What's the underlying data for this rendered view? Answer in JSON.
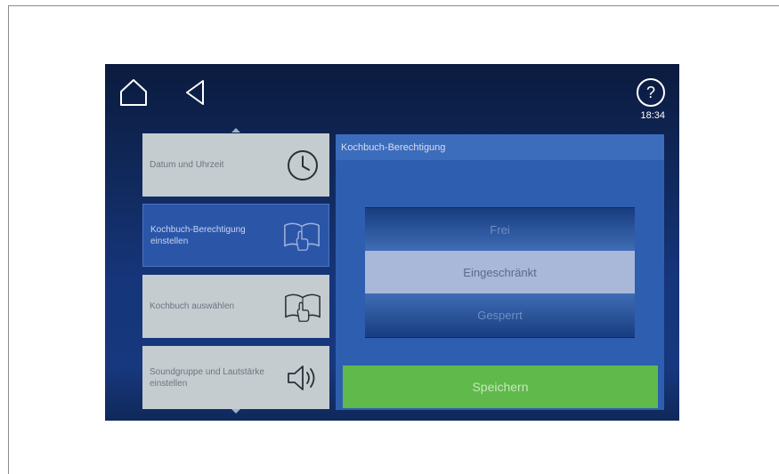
{
  "header": {
    "time": "18:34",
    "home_icon": "home-icon",
    "back_icon": "back-icon",
    "help_icon": "help-icon"
  },
  "menu": {
    "items": [
      {
        "label": "Datum und Uhrzeit",
        "icon": "clock-icon",
        "active": false
      },
      {
        "label": "Kochbuch-Berechtigung einstellen",
        "icon": "book-hand-icon",
        "active": true
      },
      {
        "label": "Kochbuch auswählen",
        "icon": "book-hand-icon",
        "active": false
      },
      {
        "label": "Soundgruppe und Lautstärke einstellen",
        "icon": "speaker-icon",
        "active": false
      }
    ]
  },
  "panel": {
    "title": "Kochbuch-Berechtigung",
    "options": [
      "Frei",
      "Eingeschränkt",
      "Gesperrt"
    ],
    "selected": "Eingeschränkt"
  },
  "save_label": "Speichern",
  "colors": {
    "screen_bg": "#10285a",
    "panel_bg": "#2e5eb0",
    "active_item": "#2b56a8",
    "inactive_item": "#c5ccd0",
    "save_button": "#5fb94b"
  }
}
